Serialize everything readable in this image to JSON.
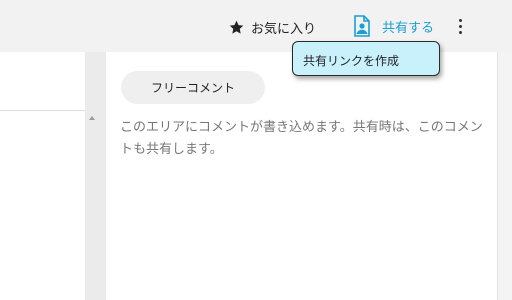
{
  "header": {
    "favorite_label": "お気に入り",
    "share_label": "共有する",
    "accent_color": "#1a9fd0"
  },
  "share_menu": {
    "items": [
      {
        "label": "共有リンクを作成"
      }
    ],
    "background": "#c9f1fc"
  },
  "comment_panel": {
    "title": "フリーコメント",
    "description": "このエリアにコメントが書き込めます。共有時は、このコメントも共有します。"
  },
  "icons": {
    "favorite": "star-icon",
    "share": "user-document-icon",
    "more": "more-vertical-icon",
    "scroll_up": "scroll-up-arrow-icon"
  }
}
